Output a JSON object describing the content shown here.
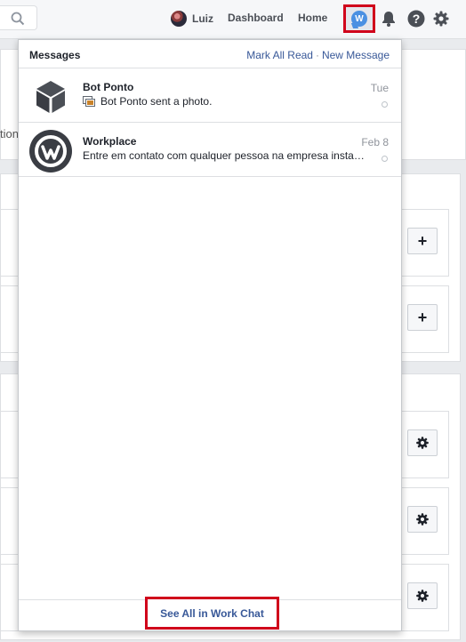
{
  "topbar": {
    "user_name": "Luiz",
    "dashboard_label": "Dashboard",
    "home_label": "Home",
    "chat_icon_letter": "W",
    "icons": [
      "search-icon",
      "work-chat-icon",
      "bell-icon",
      "help-icon",
      "gear-icon"
    ]
  },
  "background": {
    "cut_text": "tion"
  },
  "messages": {
    "title": "Messages",
    "mark_all_read": "Mark All Read",
    "separator": "·",
    "new_message": "New Message",
    "items": [
      {
        "name": "Bot Ponto",
        "snippet": "Bot Ponto sent a photo.",
        "time": "Tue",
        "has_photo_icon": true
      },
      {
        "name": "Workplace",
        "snippet": "Entre em contato com qualquer pessoa na empresa instantaneamente",
        "time": "Feb 8",
        "has_photo_icon": false
      }
    ],
    "see_all": "See All in Work Chat"
  },
  "colors": {
    "accent_blue": "#385898",
    "highlight_red": "#d0021b",
    "chat_blue": "#4a90e2"
  }
}
